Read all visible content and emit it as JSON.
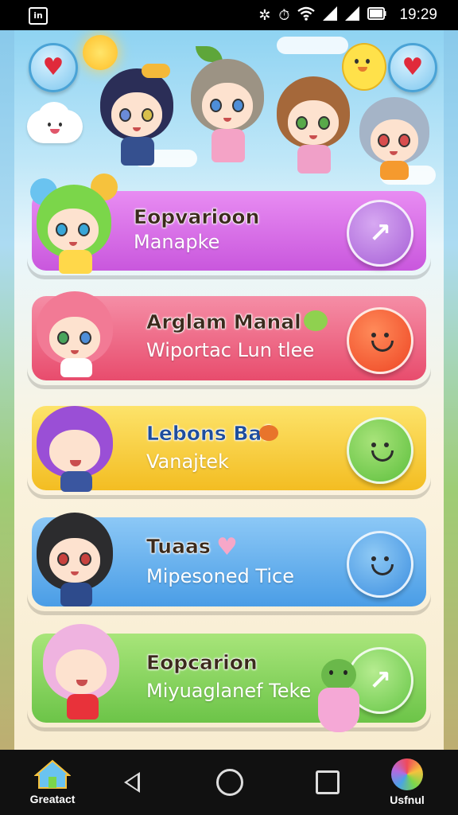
{
  "status_bar": {
    "app_badge": "in",
    "time": "19:29",
    "icons": [
      "bluetooth-icon",
      "alarm-icon",
      "wifi-icon",
      "signal-icon",
      "signal-icon",
      "battery-icon"
    ]
  },
  "header": {
    "left_button_icon": "heart-icon",
    "right_button_icon": "heart-icon"
  },
  "cards": [
    {
      "title": "Eopvarioon",
      "subtitle": "Manapke",
      "color": "#d86be6",
      "button_color": "#b66ed9",
      "button_icon": "arrow-icon"
    },
    {
      "title": "Arglam Manal",
      "subtitle": "Wiportac Lun tlee",
      "color": "#f16a86",
      "button_color": "#f2542d",
      "button_icon": "smiley-icon"
    },
    {
      "title": "Lebons Baf",
      "subtitle": "Vanajtek",
      "color": "#f7c933",
      "button_color": "#6acb4a",
      "button_icon": "smiley-icon"
    },
    {
      "title": "Tuaas",
      "subtitle": "Mipesoned Tice",
      "color": "#58a9ee",
      "button_color": "#4b9de8",
      "button_icon": "smiley-icon"
    },
    {
      "title": "Eopcarion",
      "subtitle": "Miyuaglanef Teke",
      "color": "#8ad45c",
      "button_color": "#6ec94b",
      "button_icon": "arrow-icon"
    }
  ],
  "nav": {
    "left_label": "Greatact",
    "right_label": "Usfnul"
  }
}
